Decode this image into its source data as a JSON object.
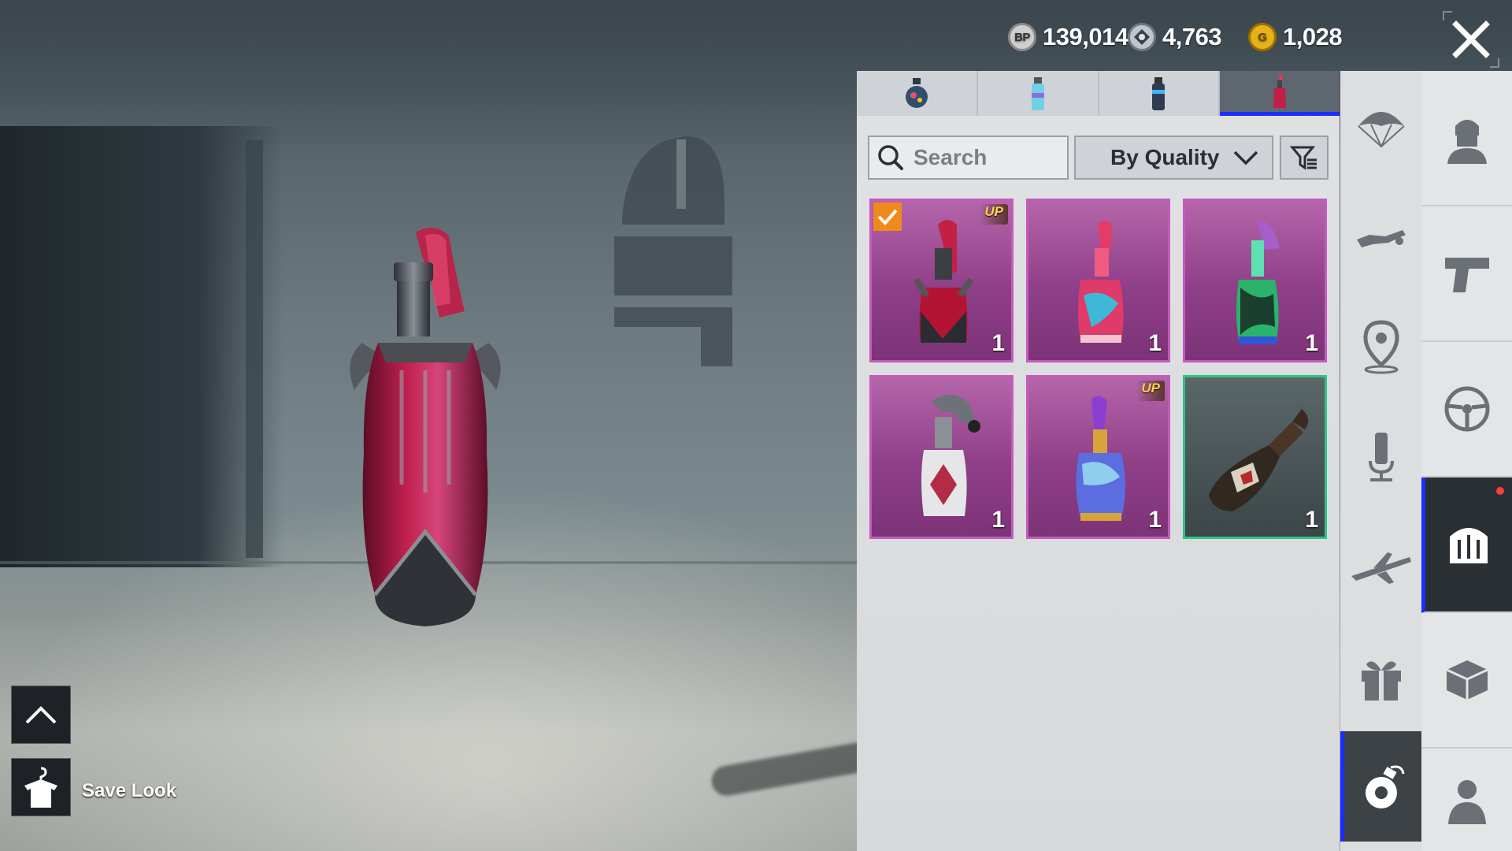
{
  "currency": {
    "bp": {
      "icon": "bp-coin-icon",
      "symbol": "BP",
      "value": "139,014"
    },
    "ag": {
      "icon": "ag-coin-icon",
      "value": "4,763"
    },
    "g": {
      "icon": "g-coin-icon",
      "symbol": "G",
      "value": "1,028"
    }
  },
  "tabs": [
    {
      "icon": "grenade-frag-icon",
      "active": false
    },
    {
      "icon": "smoke-grenade-icon",
      "active": false
    },
    {
      "icon": "stun-grenade-icon",
      "active": false
    },
    {
      "icon": "molotov-icon",
      "active": true
    }
  ],
  "search": {
    "placeholder": "Search",
    "value": ""
  },
  "sort": {
    "selected": "By Quality"
  },
  "items": [
    {
      "quality": "purple",
      "badge": "UP",
      "count": "1",
      "equipped": true,
      "icon": "dark-red-molotov-icon"
    },
    {
      "quality": "purple",
      "badge": "",
      "count": "1",
      "equipped": false,
      "icon": "pink-shark-molotov-icon"
    },
    {
      "quality": "purple",
      "badge": "",
      "count": "1",
      "equipped": false,
      "icon": "green-ribbon-molotov-icon"
    },
    {
      "quality": "purple",
      "badge": "",
      "count": "1",
      "equipped": false,
      "icon": "jester-molotov-icon"
    },
    {
      "quality": "purple",
      "badge": "UP",
      "count": "1",
      "equipped": false,
      "icon": "galaxy-molotov-icon"
    },
    {
      "quality": "green",
      "badge": "",
      "count": "1",
      "equipped": false,
      "icon": "classic-molotov-icon"
    }
  ],
  "sidebar_categories": [
    {
      "icon": "parachute-icon"
    },
    {
      "icon": "emote-skydive-icon"
    },
    {
      "icon": "location-pin-icon"
    },
    {
      "icon": "microphone-icon"
    },
    {
      "icon": "plane-icon"
    },
    {
      "icon": "gift-box-icon"
    },
    {
      "icon": "throwable-icon",
      "active": true
    }
  ],
  "sidebar_main": [
    {
      "icon": "outfit-character-icon"
    },
    {
      "icon": "pistol-icon"
    },
    {
      "icon": "steering-wheel-icon"
    },
    {
      "icon": "emblem-icon",
      "active": true,
      "notification": true
    },
    {
      "icon": "crate-icon"
    },
    {
      "icon": "character-icon"
    }
  ],
  "bottom": {
    "save_label": "Save Look"
  },
  "colors": {
    "accent": "#1b2dff",
    "purple_quality": "#c55ac0",
    "green_quality": "#2cc585",
    "equipped": "#f08b1b",
    "upgrade_badge": "#ffd24a"
  }
}
